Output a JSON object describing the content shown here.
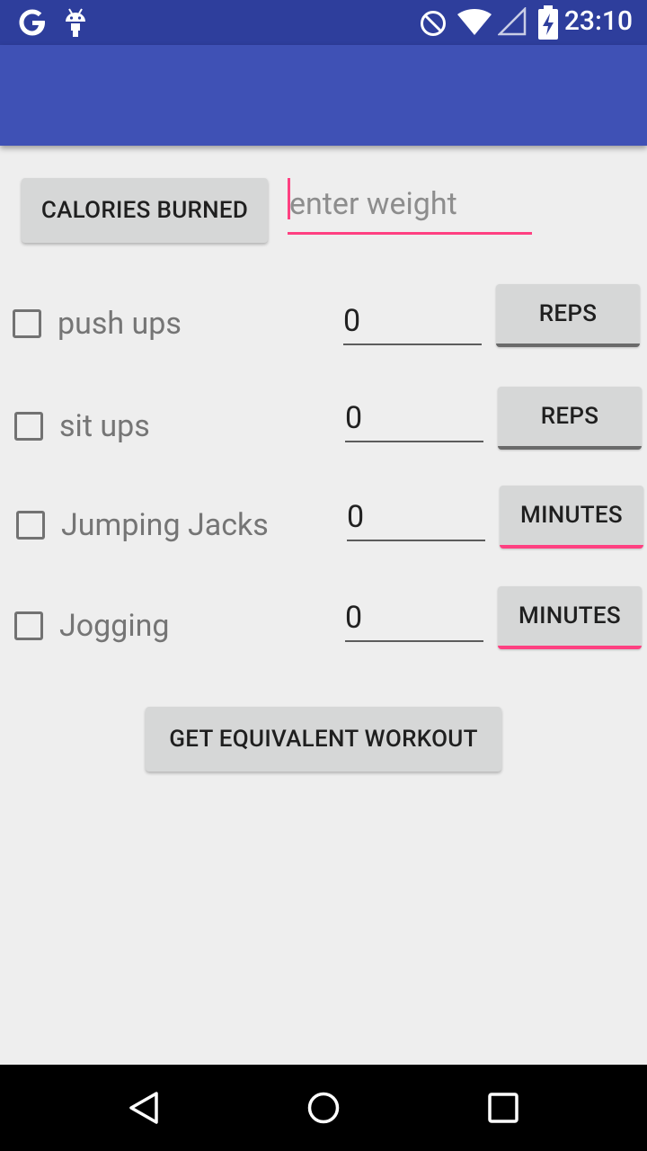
{
  "status_bar": {
    "time": "23:10",
    "icons": [
      "google-g-icon",
      "android-debug-icon",
      "do-not-disturb-icon",
      "wifi-icon",
      "signal-icon",
      "battery-charging-icon"
    ]
  },
  "calories_button": {
    "label": "CALORIES BURNED"
  },
  "weight_input": {
    "value": "",
    "placeholder": "enter weight"
  },
  "exercises": [
    {
      "label": "push ups",
      "value": "0",
      "unit_button": "REPS"
    },
    {
      "label": "sit ups",
      "value": "0",
      "unit_button": "REPS"
    },
    {
      "label": "Jumping Jacks",
      "value": "0",
      "unit_button": "MINUTES"
    },
    {
      "label": "Jogging",
      "value": "0",
      "unit_button": "MINUTES"
    }
  ],
  "equivalent_button": {
    "label": "GET EQUIVALENT WORKOUT"
  },
  "nav_bar": {
    "icons": [
      "back-icon",
      "home-icon",
      "recents-icon"
    ]
  },
  "colors": {
    "status_bar": "#2e3e9c",
    "app_bar": "#3f51b5",
    "accent": "#ff4081",
    "background": "#eeeeee"
  }
}
